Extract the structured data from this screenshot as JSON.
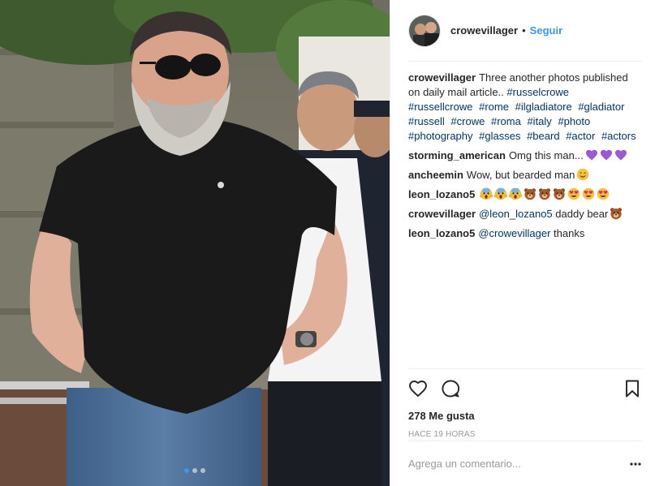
{
  "header": {
    "username": "crowevillager",
    "bullet": "•",
    "follow_label": "Seguir"
  },
  "caption": {
    "username": "crowevillager",
    "text": "Three another photos published on daily mail article..",
    "hashtags": [
      "#russelcrowe",
      "#russellcrowe",
      "#rome",
      "#ilgladiatore",
      "#gladiator",
      "#russell",
      "#crowe",
      "#roma",
      "#italy",
      "#photo",
      "#photography",
      "#glasses",
      "#beard",
      "#actor",
      "#actors"
    ]
  },
  "comments": [
    {
      "username": "storming_american",
      "text": "Omg this man...",
      "emojis": [
        "purple-heart",
        "purple-heart",
        "purple-heart"
      ]
    },
    {
      "username": "ancheemin",
      "text": "Wow, but bearded man",
      "emojis": [
        "smiling-face"
      ]
    },
    {
      "username": "leon_lozano5",
      "text": "",
      "emojis": [
        "screaming-face",
        "screaming-face",
        "screaming-face",
        "bear-face",
        "bear-face",
        "bear-face",
        "heart-eyes-face",
        "heart-eyes-face",
        "heart-eyes-face"
      ]
    },
    {
      "username": "crowevillager",
      "mention": "@leon_lozano5",
      "text": "daddy bear",
      "emojis": [
        "bear-face"
      ]
    },
    {
      "username": "leon_lozano5",
      "mention": "@crowevillager",
      "text": "thanks",
      "emojis": []
    }
  ],
  "actions": {
    "likes": "278 Me gusta",
    "time": "HACE 19 HORAS"
  },
  "add_comment": {
    "placeholder": "Agrega un comentario..."
  },
  "carousel": {
    "count": 3,
    "active_index": 0
  },
  "colors": {
    "link": "#3897f0",
    "hashtag": "#003569",
    "muted": "#999999",
    "text": "#262626"
  }
}
